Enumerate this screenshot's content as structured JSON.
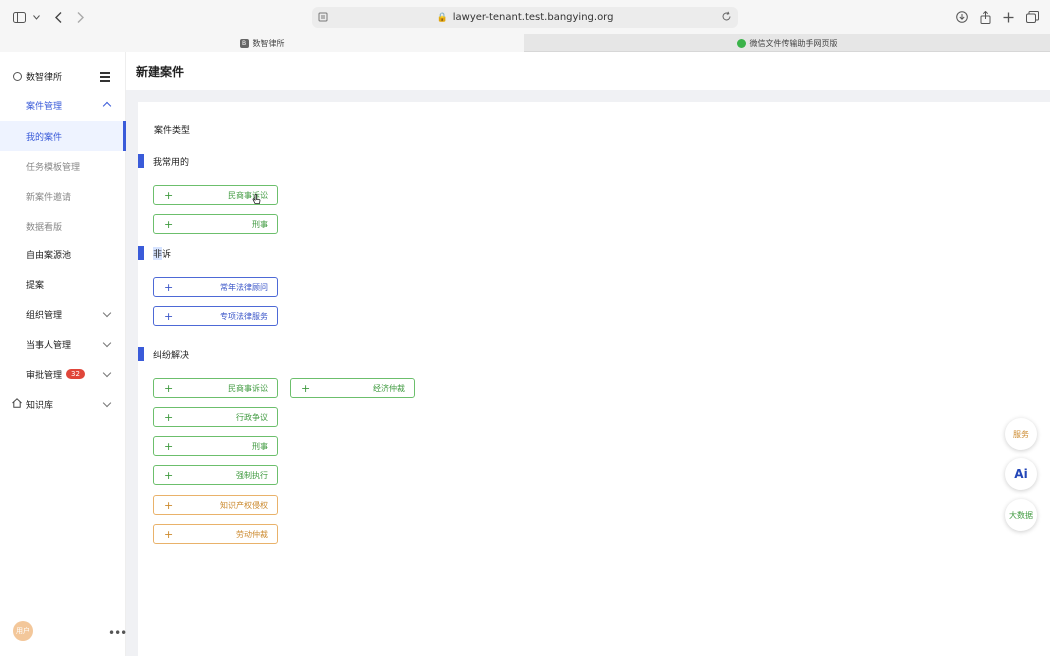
{
  "browser": {
    "url": "lawyer-tenant.test.bangying.org",
    "tabs": [
      {
        "label": "数智律所",
        "favicon": "B"
      },
      {
        "label": "微信文件传输助手网页版"
      }
    ]
  },
  "sidebar": {
    "brand": "数智律所",
    "items": [
      {
        "label": "案件管理"
      },
      {
        "label": "我的案件"
      },
      {
        "label": "任务模板管理"
      },
      {
        "label": "新案件邀请"
      },
      {
        "label": "数据看版"
      },
      {
        "label": "自由案源池"
      },
      {
        "label": "提案"
      },
      {
        "label": "组织管理"
      },
      {
        "label": "当事人管理"
      },
      {
        "label": "审批管理",
        "badge": "32"
      },
      {
        "label": "知识库"
      }
    ],
    "avatar": "用户"
  },
  "page": {
    "title": "新建案件",
    "case_type_label": "案件类型",
    "sections": [
      {
        "title_a": "我常用的",
        "title_b": "",
        "buttons": [
          "民商事诉讼",
          "刑事"
        ]
      },
      {
        "title_a": "非",
        "title_b": "诉",
        "buttons": [
          "常年法律顾问",
          "专项法律服务"
        ]
      },
      {
        "title_a": "纠纷解决",
        "title_b": "",
        "buttons": [
          "民商事诉讼",
          "经济仲裁",
          "行政争议",
          "刑事",
          "强制执行",
          "知识产权侵权",
          "劳动仲裁"
        ]
      }
    ]
  },
  "floating": {
    "service": "服务",
    "ai": "Ai",
    "bigdata": "大数据"
  },
  "colors": {
    "accent": "#3a5bd9",
    "green": "#3f9a3f",
    "orange": "#cc8a2e"
  }
}
